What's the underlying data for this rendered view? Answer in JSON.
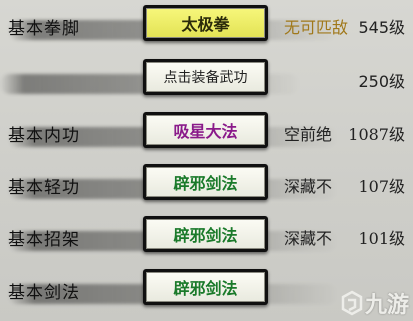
{
  "skills": [
    {
      "label": "基本拳脚",
      "equipped": "太极拳",
      "equipped_color": "#2a2a0a",
      "grade": "无可匹敌",
      "grade_color": "#a0781a",
      "value": "545级"
    },
    {
      "label": "",
      "equipped": "点击装备武功",
      "equipped_color": "#222222",
      "grade": "",
      "grade_color": "#222222",
      "value": "250级"
    },
    {
      "label": "基本内功",
      "equipped": "吸星大法",
      "equipped_color": "#8a1a8a",
      "grade": "空前绝",
      "grade_color": "#222222",
      "value": "1087级"
    },
    {
      "label": "基本轻功",
      "equipped": "辟邪剑法",
      "equipped_color": "#1a7a2a",
      "grade": "深藏不",
      "grade_color": "#222222",
      "value": "107级"
    },
    {
      "label": "基本招架",
      "equipped": "辟邪剑法",
      "equipped_color": "#1a7a2a",
      "grade": "深藏不",
      "grade_color": "#222222",
      "value": "101级"
    },
    {
      "label": "基本剑法",
      "equipped": "辟邪剑法",
      "equipped_color": "#1a7a2a",
      "grade": "",
      "grade_color": "#222222",
      "value": ""
    }
  ],
  "colors": {
    "highlight_button_bg": "#efef60"
  },
  "watermark": {
    "text": "九游",
    "icon": "jiuyou-logo-icon"
  }
}
